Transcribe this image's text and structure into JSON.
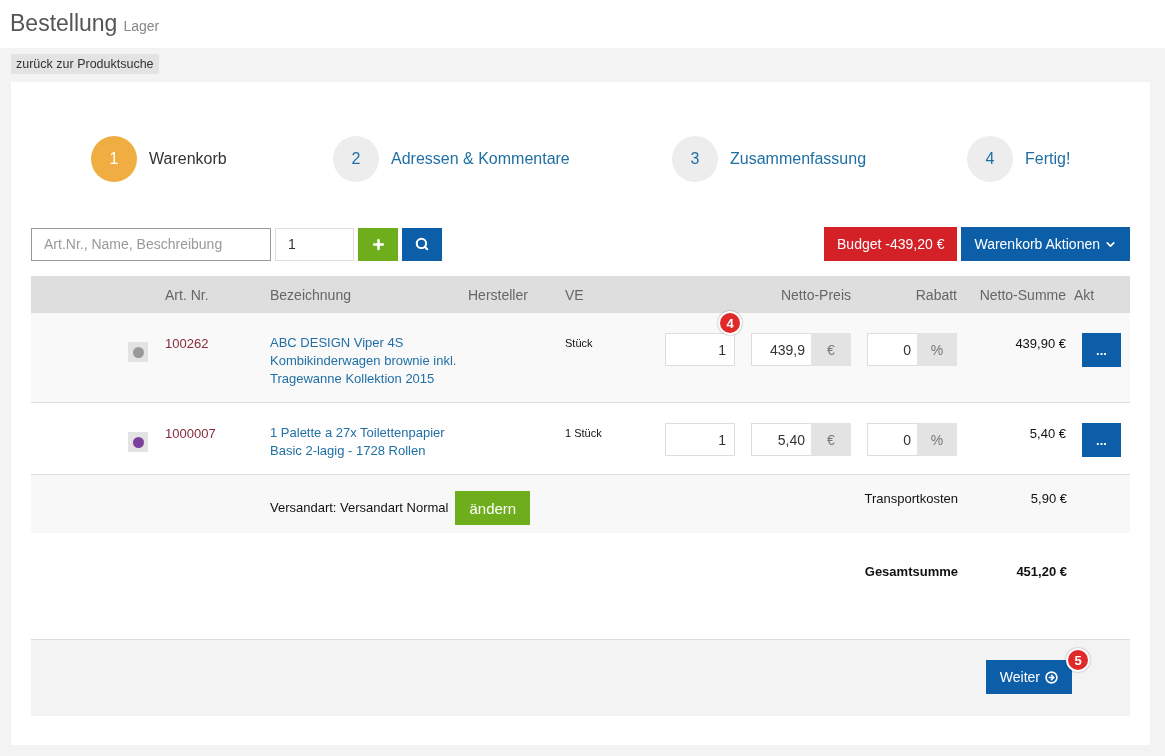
{
  "header": {
    "title": "Bestellung",
    "subtitle": "Lager"
  },
  "back_link": "zurück zur Produktsuche",
  "steps": [
    {
      "number": "1",
      "label": "Warenkorb",
      "selected": true
    },
    {
      "number": "2",
      "label": "Adressen & Kommentare",
      "selected": false
    },
    {
      "number": "3",
      "label": "Zusammenfassung",
      "selected": false
    },
    {
      "number": "4",
      "label": "Fertig!",
      "selected": false
    }
  ],
  "toolbar": {
    "search_placeholder": "Art.Nr., Name, Beschreibung",
    "quantity": "1",
    "budget_button": "Budget -439,20 €",
    "actions_button": "Warenkorb Aktionen"
  },
  "table": {
    "columns": [
      "Art. Nr.",
      "Bezeichnung",
      "Hersteller",
      "VE",
      "Netto-Preis",
      "Rabatt",
      "Netto-Summe",
      "Akt"
    ],
    "rows": [
      {
        "color": "#999999",
        "art_nr": "100262",
        "name": "ABC DESIGN Viper 4S Kombikinderwagen brownie inkl. Tragewanne Kollektion 2015",
        "unit": "Stück",
        "quantity": "1",
        "badge": "4",
        "price": "439,9",
        "currency": "€",
        "discount": "0",
        "percent": "%",
        "sum": "439,90 €",
        "action": "..."
      },
      {
        "color": "#7b3f9e",
        "art_nr": "1000007",
        "name": "1 Palette a 27x Toilettenpapier Basic 2-lagig - 1728 Rollen",
        "unit": "1 Stück",
        "quantity": "1",
        "price": "5,40",
        "currency": "€",
        "discount": "0",
        "percent": "%",
        "sum": "5,40 €",
        "action": "..."
      }
    ]
  },
  "shipping": {
    "text": "Versandart: Versandart Normal",
    "change_button": "ändern",
    "label": "Transportkosten",
    "value": "5,90 €"
  },
  "total": {
    "label": "Gesamtsumme",
    "value": "451,20 €"
  },
  "continue_button": {
    "label": "Weiter",
    "badge": "5"
  }
}
